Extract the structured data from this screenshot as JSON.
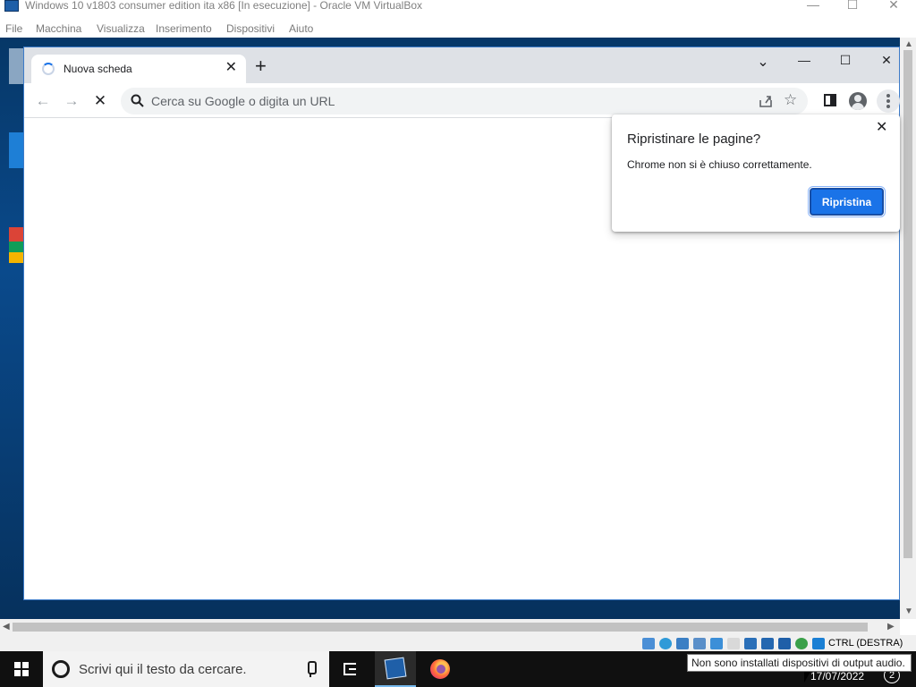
{
  "vbox": {
    "title": "Windows 10 v1803 consumer edition ita x86 [In esecuzione] - Oracle VM VirtualBox",
    "controls": {
      "minimize": "—",
      "maximize": "☐",
      "close": "✕"
    },
    "menu": [
      "File",
      "Macchina",
      "Visualizza",
      "Inserimento",
      "Dispositivi",
      "Aiuto"
    ],
    "status": {
      "host_key": "CTRL (DESTRA)"
    },
    "tooltip": "Non sono installati dispositivi di output audio."
  },
  "chrome": {
    "tab": {
      "title": "Nuova scheda",
      "close": "✕"
    },
    "new_tab": "+",
    "window_controls": {
      "tab_search": "⌄",
      "minimize": "—",
      "maximize": "☐",
      "close": "✕"
    },
    "toolbar": {
      "back": "←",
      "forward": "→",
      "stop": "✕",
      "star": "☆"
    },
    "omnibox": {
      "placeholder": "Cerca su Google o digita un URL"
    },
    "restore_bubble": {
      "title": "Ripristinare le pagine?",
      "message": "Chrome non si è chiuso correttamente.",
      "button": "Ripristina",
      "close": "✕"
    }
  },
  "taskbar": {
    "search_placeholder": "Scrivi qui il testo da cercare.",
    "date": "17/07/2022",
    "notifications": "2"
  },
  "colors": {
    "desktop": "#0a4a8c",
    "accent": "#1a73e8",
    "tabstrip": "#dee1e6",
    "taskbar": "#101010"
  }
}
